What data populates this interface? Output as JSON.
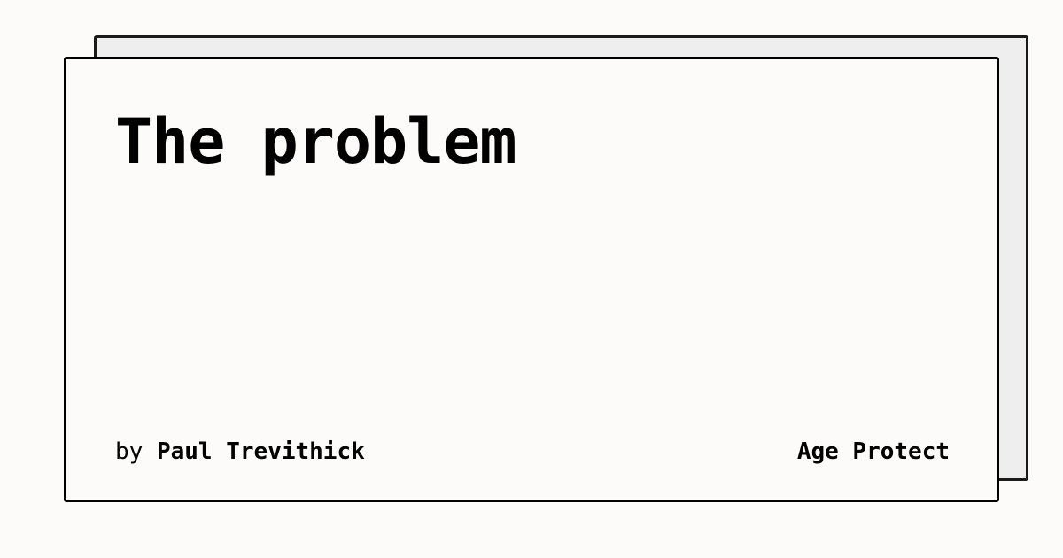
{
  "title": "The problem",
  "byline": {
    "prefix": "by",
    "author": "Paul Trevithick"
  },
  "site": "Age Protect"
}
